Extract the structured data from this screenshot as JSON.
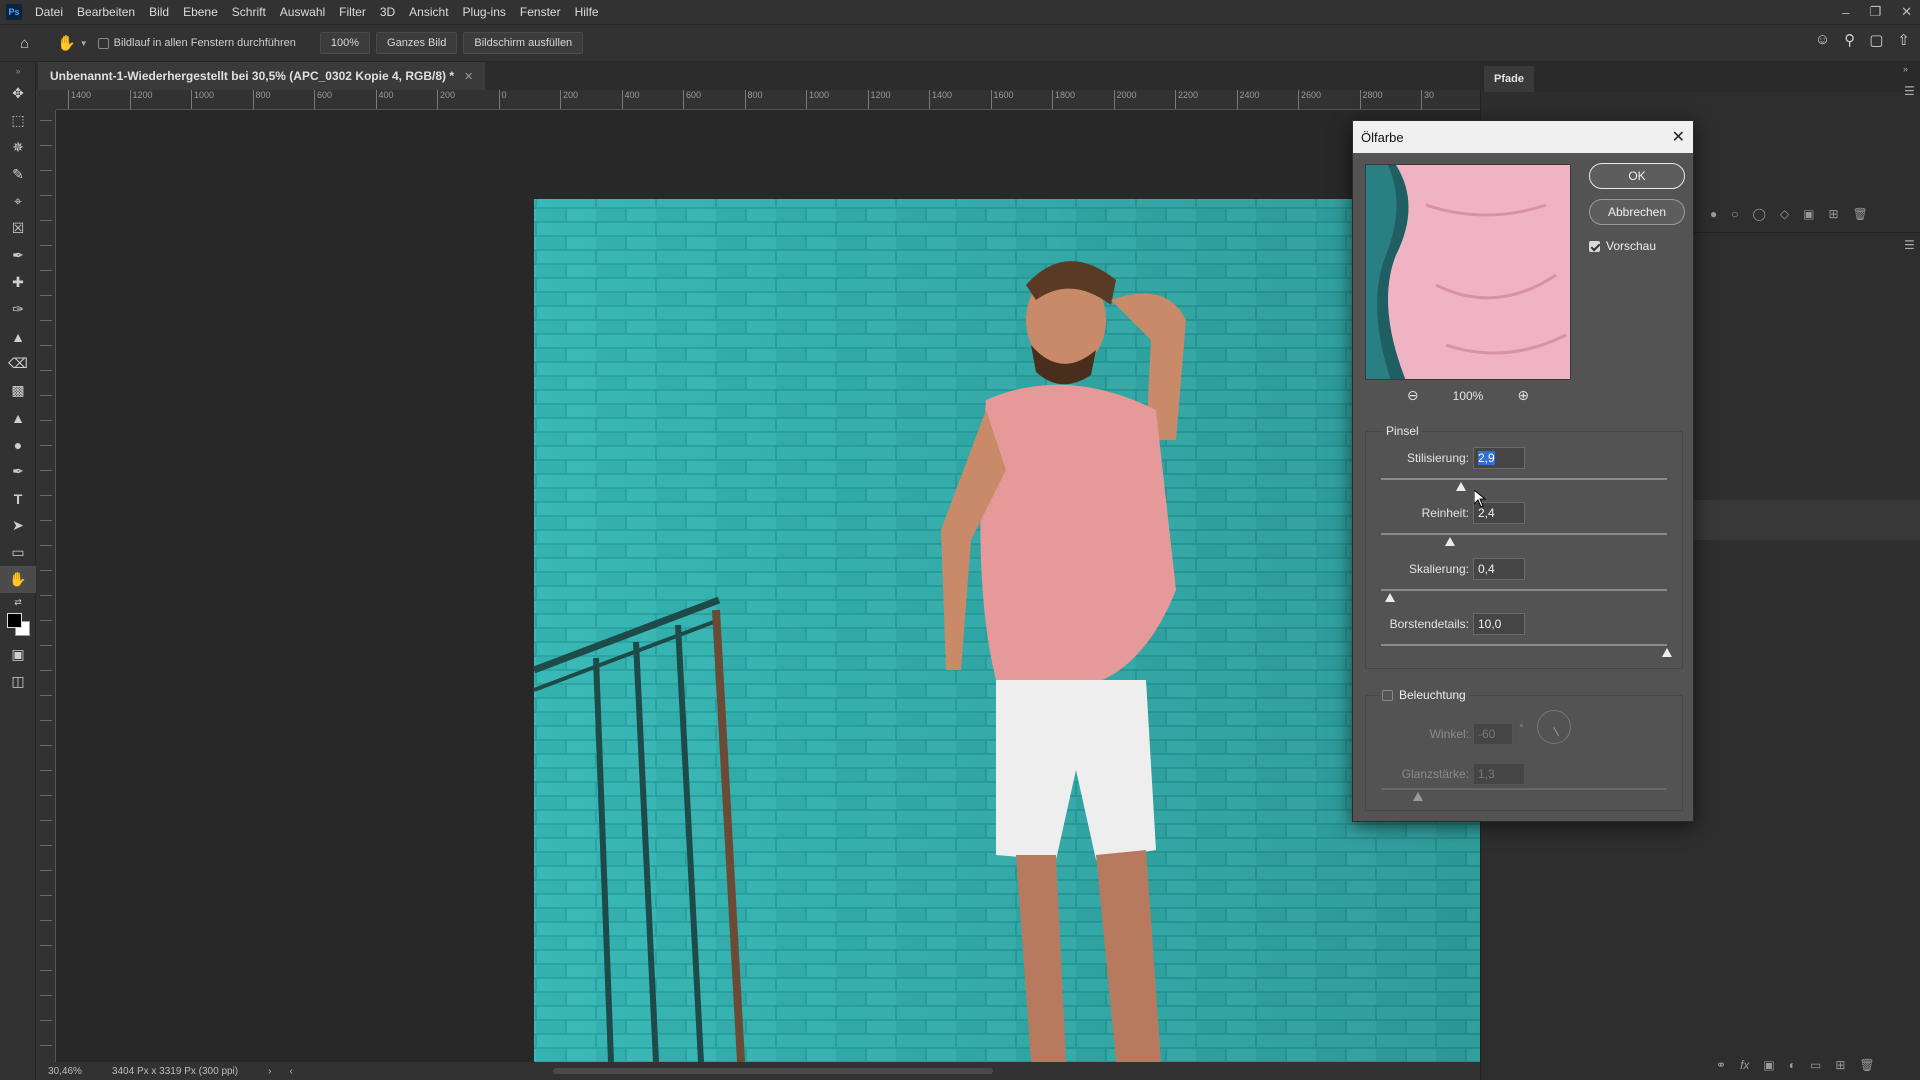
{
  "menubar": {
    "logo": "Ps",
    "items": [
      "Datei",
      "Bearbeiten",
      "Bild",
      "Ebene",
      "Schrift",
      "Auswahl",
      "Filter",
      "3D",
      "Ansicht",
      "Plug-ins",
      "Fenster",
      "Hilfe"
    ],
    "window_controls": [
      "minimize-icon",
      "restore-icon",
      "close-icon"
    ]
  },
  "optionsbar": {
    "scroll_all_label": "Bildlauf in allen Fenstern durchführen",
    "zoom_100_label": "100%",
    "fit_screen_label": "Ganzes Bild",
    "fill_screen_label": "Bildschirm ausfüllen"
  },
  "document": {
    "tab_title": "Unbenannt-1-Wiederhergestellt bei 30,5% (APC_0302 Kopie 4, RGB/8) *",
    "zoom_status": "30,46%",
    "doc_info": "3404 Px x 3319 Px (300 ppi)"
  },
  "ruler": {
    "h_labels": [
      "1400",
      "1200",
      "1000",
      "800",
      "600",
      "400",
      "200",
      "0",
      "200",
      "400",
      "600",
      "800",
      "1000",
      "1200",
      "1400",
      "1600",
      "1800",
      "2000",
      "2200",
      "2400",
      "2600",
      "2800",
      "30"
    ]
  },
  "panel": {
    "tab": "Pfade"
  },
  "dialog": {
    "title": "Ölfarbe",
    "ok_label": "OK",
    "cancel_label": "Abbrechen",
    "preview_label": "Vorschau",
    "preview_checked": true,
    "zoom_level": "100%",
    "brush_group": "Pinsel",
    "stylization": {
      "label": "Stilisierung:",
      "value": "2,9",
      "fraction": 0.28
    },
    "cleanliness": {
      "label": "Reinheit:",
      "value": "2,4",
      "fraction": 0.24
    },
    "scale": {
      "label": "Skalierung:",
      "value": "0,4",
      "fraction": 0.03
    },
    "bristle": {
      "label": "Borstendetails:",
      "value": "10,0",
      "fraction": 1.0
    },
    "lighting_group": "Beleuchtung",
    "lighting_checked": false,
    "angle": {
      "label": "Winkel:",
      "value": "-60",
      "unit": "°"
    },
    "shine": {
      "label": "Glanzstärke:",
      "value": "1,3",
      "fraction": 0.13
    }
  }
}
